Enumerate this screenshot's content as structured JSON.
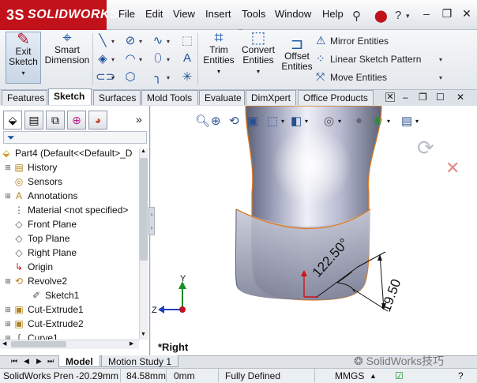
{
  "app": {
    "logo_brand": "SOLIDWORKS",
    "logo_mark": "3S"
  },
  "menu": [
    "File",
    "Edit",
    "View",
    "Insert",
    "Tools",
    "Window",
    "Help"
  ],
  "ribbon": {
    "exit_sketch": [
      "Exit",
      "Sketch"
    ],
    "smart_dimension": [
      "Smart",
      "Dimension"
    ],
    "trim_entities": [
      "Trim",
      "Entities"
    ],
    "convert_entities": [
      "Convert",
      "Entities"
    ],
    "offset_entities": [
      "Offset",
      "Entities"
    ],
    "mirror_entities": "Mirror Entities",
    "linear_pattern": "Linear Sketch Pattern",
    "move_entities": "Move Entities"
  },
  "tabs": [
    "Features",
    "Sketch",
    "Surfaces",
    "Mold Tools",
    "Evaluate",
    "DimXpert",
    "Office Products"
  ],
  "active_tab": "Sketch",
  "tree": {
    "root": "Part4  (Default<<Default>_D",
    "items": [
      {
        "label": "History",
        "icon": "history-icon",
        "expandable": true
      },
      {
        "label": "Sensors",
        "icon": "sensor-icon",
        "expandable": false
      },
      {
        "label": "Annotations",
        "icon": "annotation-icon",
        "expandable": true
      },
      {
        "label": "Material <not specified>",
        "icon": "material-icon",
        "expandable": false
      },
      {
        "label": "Front Plane",
        "icon": "plane-icon",
        "expandable": false
      },
      {
        "label": "Top Plane",
        "icon": "plane-icon",
        "expandable": false
      },
      {
        "label": "Right Plane",
        "icon": "plane-icon",
        "expandable": false
      },
      {
        "label": "Origin",
        "icon": "origin-icon",
        "expandable": false
      },
      {
        "label": "Revolve2",
        "icon": "revolve-icon",
        "expandable": true
      },
      {
        "label": "Sketch1",
        "icon": "sketch-icon",
        "expandable": false
      },
      {
        "label": "Cut-Extrude1",
        "icon": "cut-extrude-icon",
        "expandable": true
      },
      {
        "label": "Cut-Extrude2",
        "icon": "cut-extrude-icon",
        "expandable": true
      },
      {
        "label": "Curve1",
        "icon": "curve-icon",
        "expandable": true
      }
    ]
  },
  "viewport": {
    "view_name": "*Right",
    "dim_angle": "122.50°",
    "dim_length": "19.50",
    "axis_y": "Y",
    "axis_z": "Z"
  },
  "bottom_tabs": [
    "Model",
    "Motion Study 1"
  ],
  "status": {
    "product": "SolidWorks Pren",
    "x": "-20.29mm",
    "y": "84.58mm",
    "z": "0mm",
    "state": "Fully Defined",
    "units": "MMGS"
  },
  "watermark": "SolidWorks技巧",
  "colors": {
    "brand_red": "#c1121c",
    "accent_blue": "#1e4f9a",
    "edge_orange": "#e07a1e"
  }
}
